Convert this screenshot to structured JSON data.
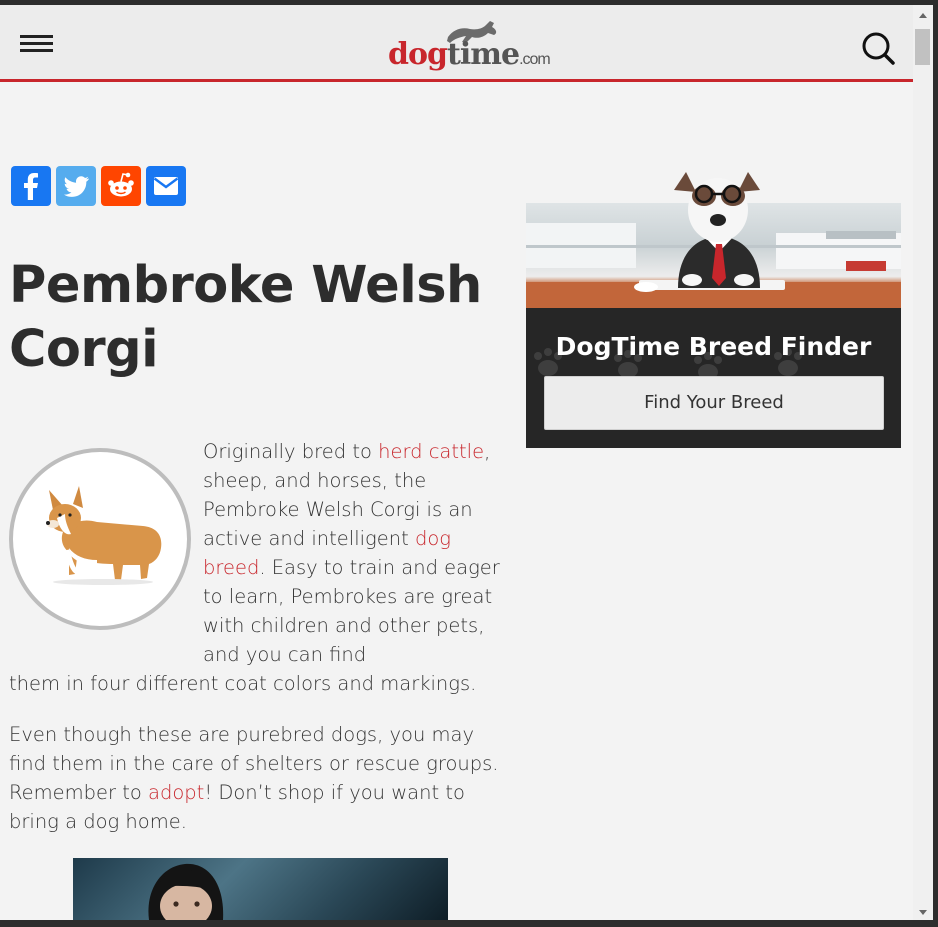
{
  "header": {
    "logo": {
      "dog": "dog",
      "time": "time",
      "com": ".com"
    }
  },
  "share": {
    "icons": [
      "facebook-icon",
      "twitter-icon",
      "reddit-icon",
      "email-icon"
    ],
    "colors": {
      "facebook": "#1877f2",
      "twitter": "#55acee",
      "reddit": "#ff4500",
      "email": "#1877f2"
    }
  },
  "article": {
    "title": "Pembroke Welsh Corgi",
    "paragraph1": {
      "t1": "Originally bred to ",
      "link1": "herd cattle",
      "t2": ", sheep, and horses, the Pembroke Welsh Corgi is an active and intelligent ",
      "link2": "dog breed",
      "t3": ". Easy to train and eager to learn, Pembrokes are great with children and other pets, and you can find",
      "t4": "them in four different coat colors and markings."
    },
    "paragraph2": {
      "t1": "Even though these are purebred dogs, you may find them in the care of shelters or rescue groups. Remember to ",
      "link": "adopt",
      "t2": "! Don’t shop if you want to bring a dog home."
    }
  },
  "sidebar": {
    "finder_title": "DogTime Breed Finder",
    "finder_button": "Find Your Breed"
  },
  "colors": {
    "accent": "#c8262c",
    "dark_panel": "#262626"
  }
}
